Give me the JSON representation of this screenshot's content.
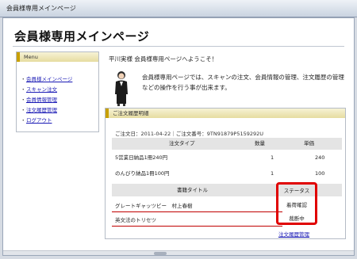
{
  "window": {
    "title": "会員様専用メインページ"
  },
  "page": {
    "title": "会員様専用メインページ"
  },
  "menu": {
    "heading": "Menu",
    "items": [
      "会員様メインページ",
      "スキャン注文",
      "会員情報管理",
      "注文履歴管理",
      "ログアウト"
    ]
  },
  "welcome": "平川実様 会員様専用ページへようこそ！",
  "info": "会員様専用ページでは、スキャンの注文、会員情報の管理、注文履歴の管理などの操作を行う事が出来ます。",
  "history": {
    "heading": "ご注文履歴明細",
    "order_line": "ご注文日：2011-04-22｜ご注文番号：9TN91879P5159292U",
    "columns": {
      "type": "注文タイプ",
      "qty": "数量",
      "price": "単価"
    },
    "orders": [
      {
        "type": "5営業日納品1冊240円",
        "qty": "1",
        "price": "240"
      },
      {
        "type": "のんびり納品1冊100円",
        "qty": "1",
        "price": "100"
      }
    ],
    "book_columns": {
      "title": "書籍タイトル",
      "status": "ステータス"
    },
    "books": [
      {
        "title": "グレートギャッツビー　村上春樹",
        "status": "着荷確認"
      },
      {
        "title": "英文法のトリセツ",
        "status": "裁断中"
      }
    ],
    "link": "注文履歴管理"
  }
}
